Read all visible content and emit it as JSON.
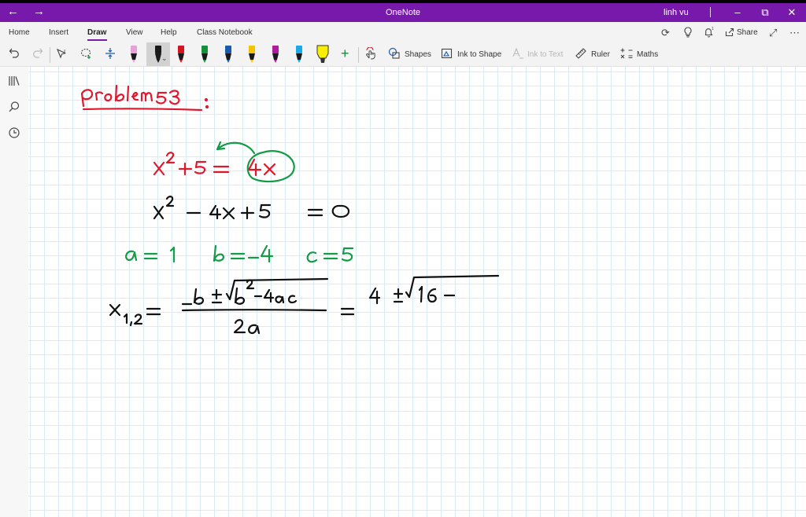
{
  "titlebar": {
    "app_title": "OneNote",
    "user_name": "linh vu",
    "back": "←",
    "forward": "→",
    "minimize": "–",
    "restore": "⧉",
    "close": "✕"
  },
  "tabs": [
    "Home",
    "Insert",
    "Draw",
    "View",
    "Help",
    "Class Notebook"
  ],
  "ribbon_right": {
    "share_label": "Share",
    "sync": "⟳",
    "ideas": "♡",
    "notify": "🔔",
    "expand": "⤢",
    "more": "⋯"
  },
  "toolbar": {
    "shapes_label": "Shapes",
    "ink_to_shape_label": "Ink to Shape",
    "ink_to_text_label": "Ink to Text",
    "ruler_label": "Ruler",
    "maths_label": "Maths",
    "pen_colors": [
      "#e8a0d8",
      "#1a1a1a",
      "#d4141e",
      "#17903c",
      "#1a5bb0",
      "#f5c400",
      "#b01a9c",
      "#1aa9e8",
      "#f8f000"
    ]
  },
  "sidebar": {
    "notebooks": "☰",
    "search": "⌕",
    "recent": "◷"
  },
  "note": {
    "colors": {
      "red": "#e0182d",
      "green": "#139b45",
      "black": "#111111"
    }
  }
}
